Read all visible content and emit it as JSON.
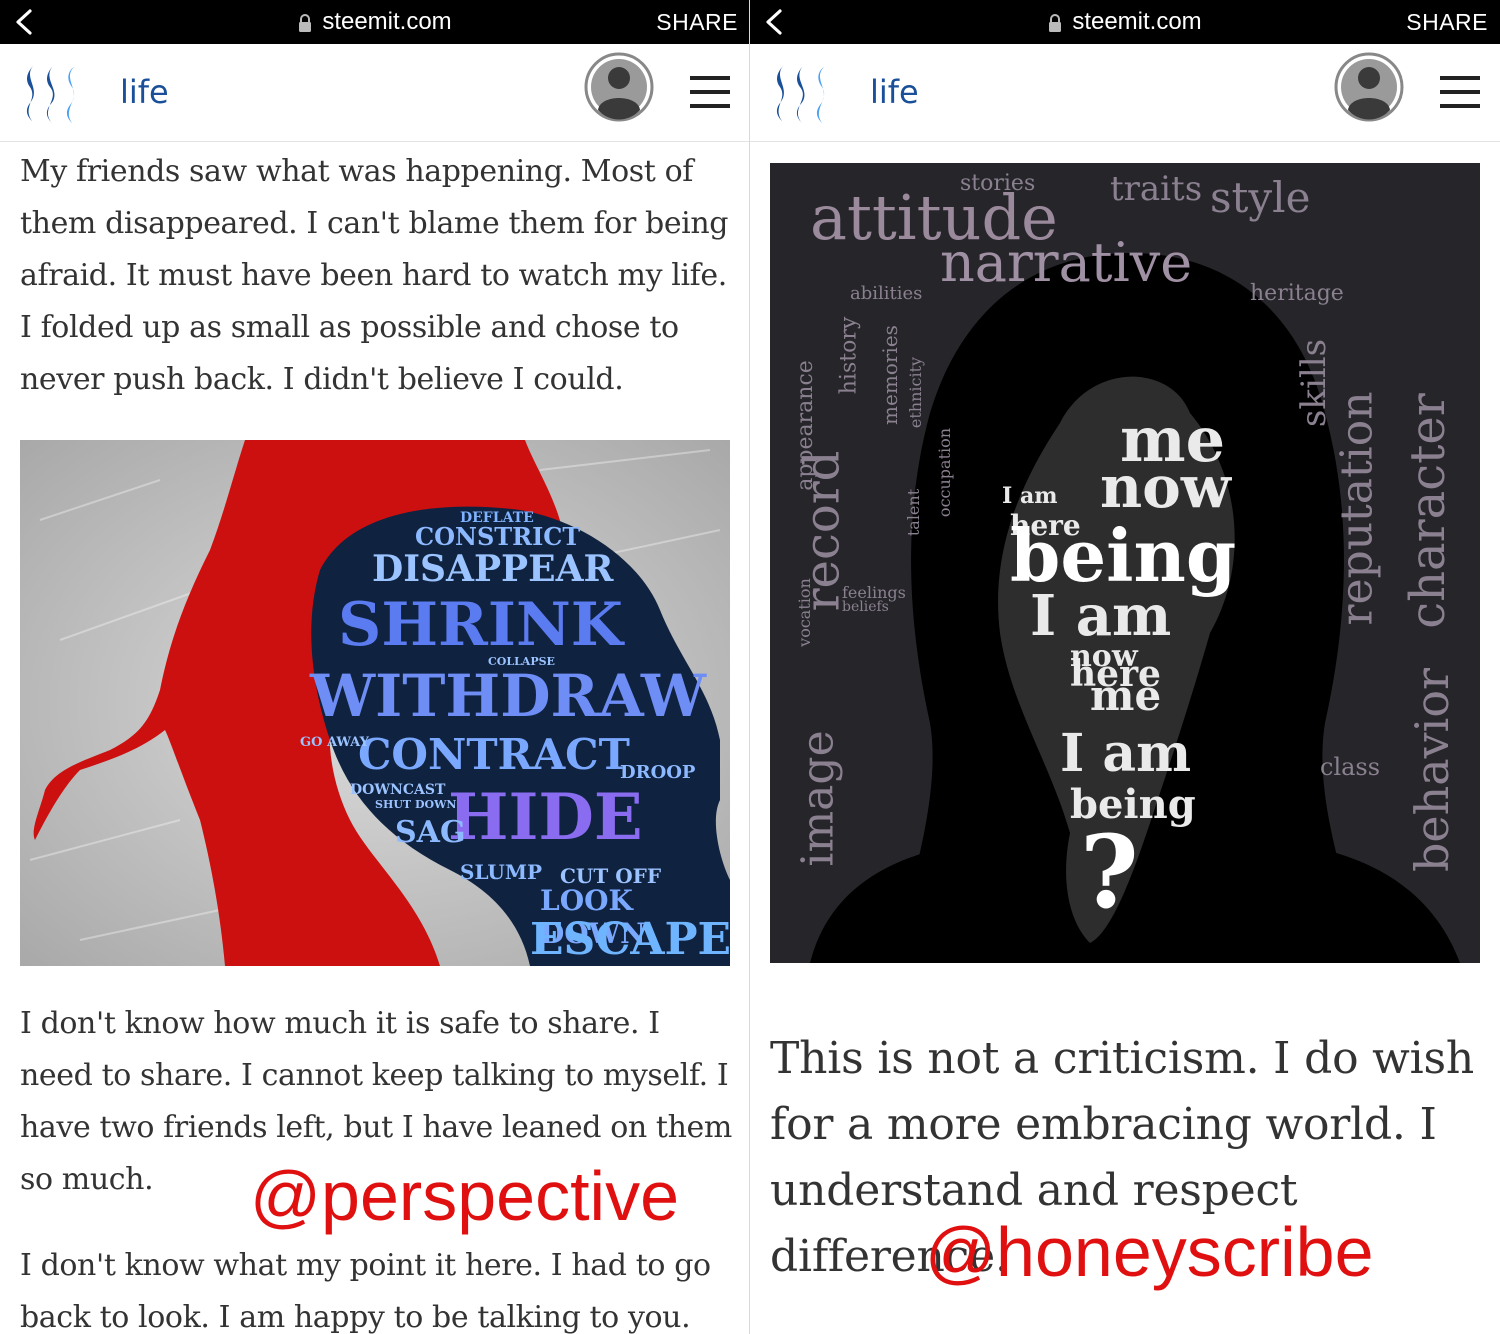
{
  "left": {
    "browser": {
      "url": "steemit.com",
      "share_label": "SHARE"
    },
    "header": {
      "category": "life"
    },
    "paragraph1": "My friends saw what was happening. Most of them disappeared. I can't blame them for being afraid. It must have been hard to watch my life. I folded up as small as possible and chose to never push back. I didn't believe I could.",
    "image_words": [
      "DEFLATE",
      "CONSTRICT",
      "DISAPPEAR",
      "SHRINK",
      "WITHDRAW",
      "CONTRACT",
      "HIDE",
      "SAG",
      "SLUMP",
      "CUT OFF",
      "LOOK DOWN",
      "ESCAPE",
      "DROOP",
      "DOWNCAST",
      "SHUT DOWN",
      "GO AWAY",
      "COLLAPSE"
    ],
    "paragraph2": "I don't know how much it is safe to share. I need to share. I cannot keep talking to myself. I have two friends left, but I have leaned on them so much.",
    "watermark": "@perspective",
    "paragraph3": "I don't know what my point it here. I had to go back to look. I am happy to be talking to you."
  },
  "right": {
    "browser": {
      "url": "steemit.com",
      "share_label": "SHARE"
    },
    "header": {
      "category": "life"
    },
    "image_words_outer": [
      "attitude",
      "stories",
      "traits",
      "style",
      "narrative",
      "heritage",
      "record",
      "image",
      "abilities",
      "reputation",
      "behavior",
      "character",
      "skills",
      "class",
      "feelings",
      "beliefs",
      "history",
      "memories",
      "ethnicity",
      "talent",
      "occupation",
      "vocation",
      "appearance"
    ],
    "image_words_inner": [
      "me",
      "now",
      "I am",
      "here",
      "being",
      "I am",
      "now",
      "here",
      "me",
      "I am",
      "being",
      "?"
    ],
    "paragraph": "This is not a criticism. I do wish for a more embracing world. I understand and respect difference.",
    "watermark": "@honeyscribe"
  },
  "colors": {
    "link_blue": "#1a5099",
    "watermark_red": "#e01010",
    "silhouette_red": "#cc1010",
    "word_blue": "#5b7bf0"
  }
}
